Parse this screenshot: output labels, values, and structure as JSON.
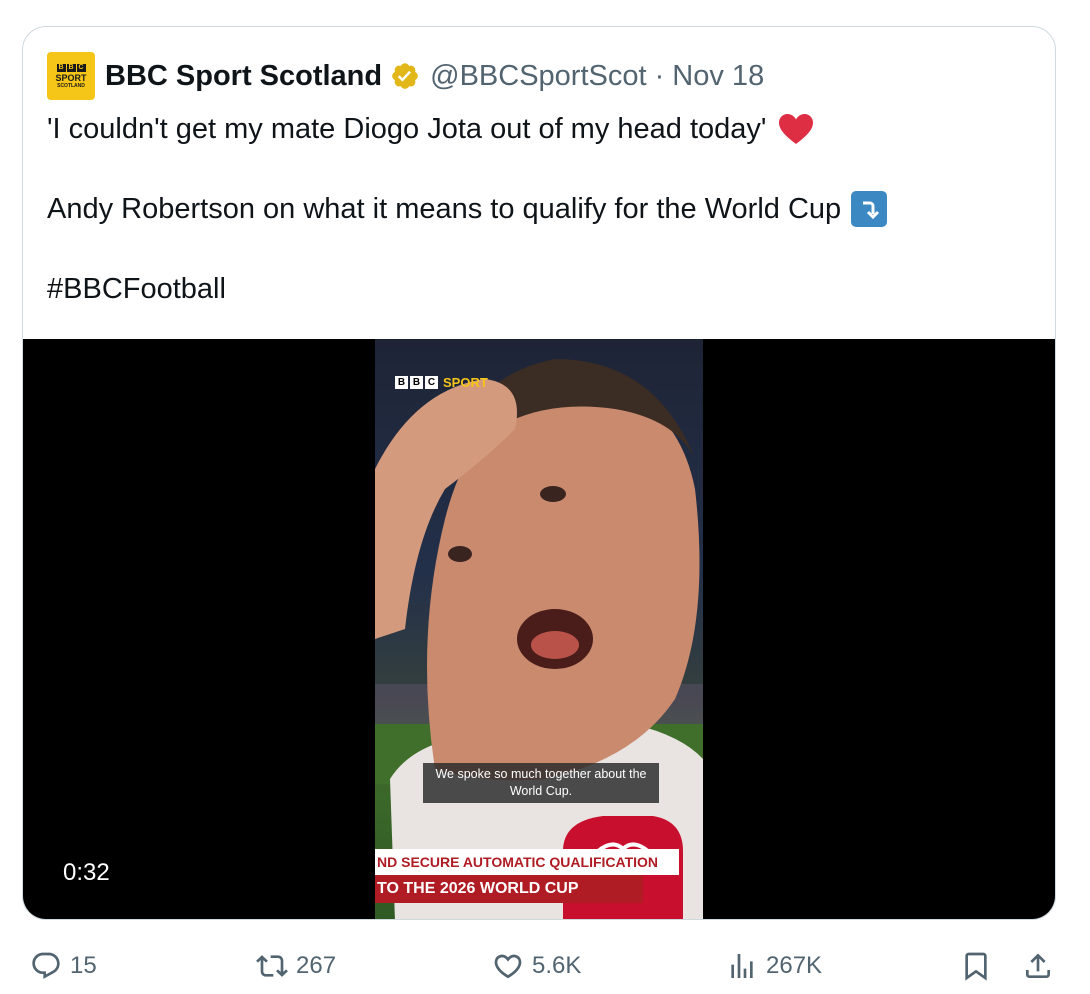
{
  "author": {
    "name": "BBC Sport Scotland",
    "handle": "@BBCSportScot · Nov 18",
    "avatar_text": {
      "line1": "SPORT",
      "line2": "SCOTLAND",
      "blocks": [
        "B",
        "B",
        "C"
      ]
    }
  },
  "tweet": {
    "line1": "'I couldn't get my mate Diogo Jota out of my head today'",
    "line2": "Andy Robertson on what it means to qualify for the World Cup",
    "line3": "#BBCFootball"
  },
  "video": {
    "logo_blocks": [
      "B",
      "B",
      "C"
    ],
    "logo_sport": "SPORT",
    "subtitle": "We spoke so much together about the World Cup.",
    "lower_third_1": "ND SECURE AUTOMATIC QUALIFICATION",
    "lower_third_2": "TO THE 2026 WORLD CUP",
    "duration": "0:32"
  },
  "actions": {
    "replies": "15",
    "retweets": "267",
    "likes": "5.6K",
    "views": "267K"
  },
  "colors": {
    "text_primary": "#0f1419",
    "text_secondary": "#536471",
    "border": "#cfd9de",
    "verified_gold": "#e2b719",
    "heart_red": "#dd2e44",
    "arrow_blue": "#3b88c3",
    "bbc_red": "#b01c24"
  },
  "icons": [
    "reply-icon",
    "retweet-icon",
    "like-icon",
    "views-icon",
    "bookmark-icon",
    "share-icon",
    "verified-badge-icon",
    "heart-emoji-icon",
    "arrow-curve-down-icon"
  ]
}
